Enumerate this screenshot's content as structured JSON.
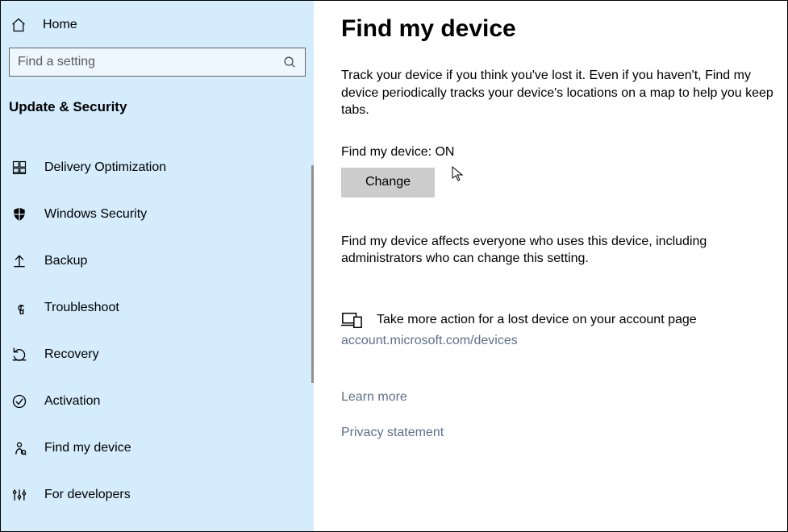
{
  "sidebar": {
    "home": "Home",
    "search_placeholder": "Find a setting",
    "category": "Update & Security",
    "items": [
      {
        "label": "Delivery Optimization"
      },
      {
        "label": "Windows Security"
      },
      {
        "label": "Backup"
      },
      {
        "label": "Troubleshoot"
      },
      {
        "label": "Recovery"
      },
      {
        "label": "Activation"
      },
      {
        "label": "Find my device"
      },
      {
        "label": "For developers"
      }
    ]
  },
  "main": {
    "title": "Find my device",
    "description": "Track your device if you think you've lost it. Even if you haven't, Find my device periodically tracks your device's locations on a map to help you keep tabs.",
    "status": "Find my device: ON",
    "change_button": "Change",
    "note": "Find my device affects everyone who uses this device, including administrators who can change this setting.",
    "action_text": "Take more action for a lost device on your account page",
    "action_link": "account.microsoft.com/devices",
    "learn_more": "Learn more",
    "privacy": "Privacy statement"
  }
}
